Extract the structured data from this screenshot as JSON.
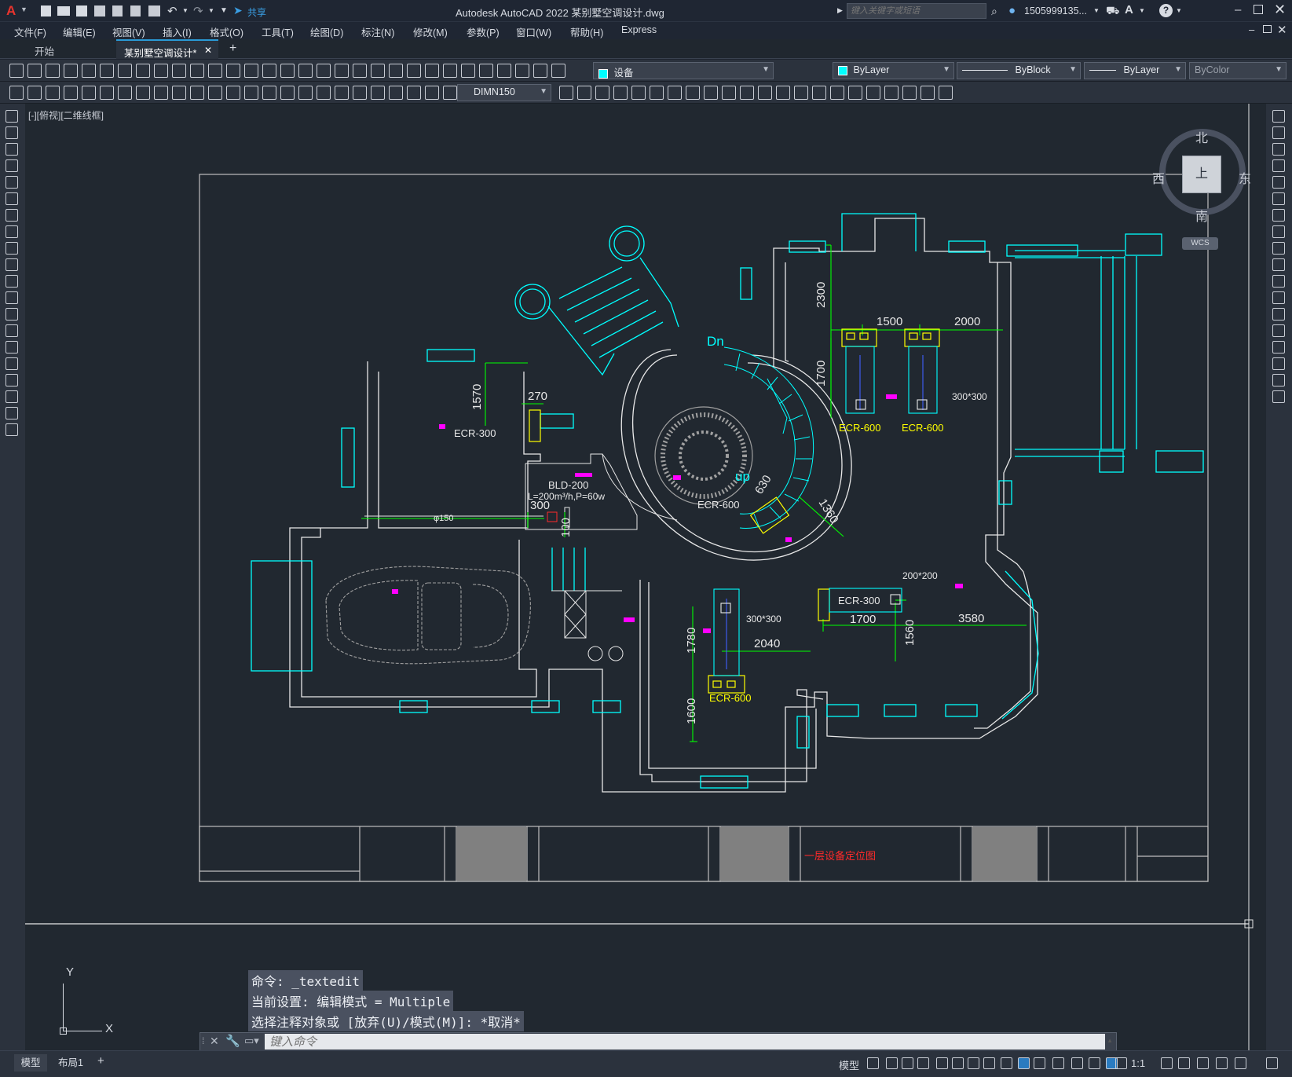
{
  "window": {
    "title": "Autodesk AutoCAD 2022    某别墅空调设计.dwg",
    "share_label": "共享",
    "search_placeholder": "键入关键字或短语",
    "user": "1505999135...",
    "colors": {
      "accent": "#2a9ad6",
      "cyan": "#00ffff",
      "green": "#00ff00",
      "yellow": "#ffff00",
      "magenta": "#ff00ff",
      "red": "#ff2a2a",
      "white": "#e8e8e8"
    }
  },
  "menu": [
    "文件(F)",
    "编辑(E)",
    "视图(V)",
    "插入(I)",
    "格式(O)",
    "工具(T)",
    "绘图(D)",
    "标注(N)",
    "修改(M)",
    "参数(P)",
    "窗口(W)",
    "帮助(H)",
    "Express"
  ],
  "tabs": {
    "start": "开始",
    "active": "某别墅空调设计*"
  },
  "toolbar": {
    "layer": "设备",
    "color": "ByLayer",
    "linetype": "ByBlock",
    "lineweight": "ByLayer",
    "plotstyle": "ByColor",
    "dimstyle": "DIMN150"
  },
  "viewport": {
    "label": "[-][俯视][二维线框]",
    "viewcube": {
      "north": "北",
      "south": "南",
      "east": "东",
      "west": "西",
      "top": "上",
      "wcs": "WCS"
    },
    "ucs": {
      "x": "X",
      "y": "Y"
    }
  },
  "drawing": {
    "dims": [
      "2300",
      "1500",
      "2000",
      "1700",
      "1570",
      "270",
      "300",
      "100",
      "630",
      "1360",
      "1700",
      "3580",
      "1560",
      "2040",
      "1780",
      "1600"
    ],
    "units": [
      "ECR-600",
      "ECR-600",
      "ECR-300",
      "ECR-600",
      "ECR-300",
      "ECR-600"
    ],
    "labels": {
      "bld": "BLD-200",
      "flow": "L=200m³/h,P=60w",
      "vent1": "300*300",
      "vent2": "300*300",
      "vent3": "200*200",
      "pipe": "φ150",
      "dn": "Dn",
      "up": "up",
      "sheet_title": "一层设备定位图"
    }
  },
  "command": {
    "history": [
      "命令: _textedit",
      "当前设置: 编辑模式 = Multiple",
      "选择注释对象或 [放弃(U)/模式(M)]: *取消*"
    ],
    "placeholder": "键入命令"
  },
  "status": {
    "model_tab": "模型",
    "layout_tab": "布局1",
    "model_btn": "模型",
    "scale": "1:1"
  }
}
